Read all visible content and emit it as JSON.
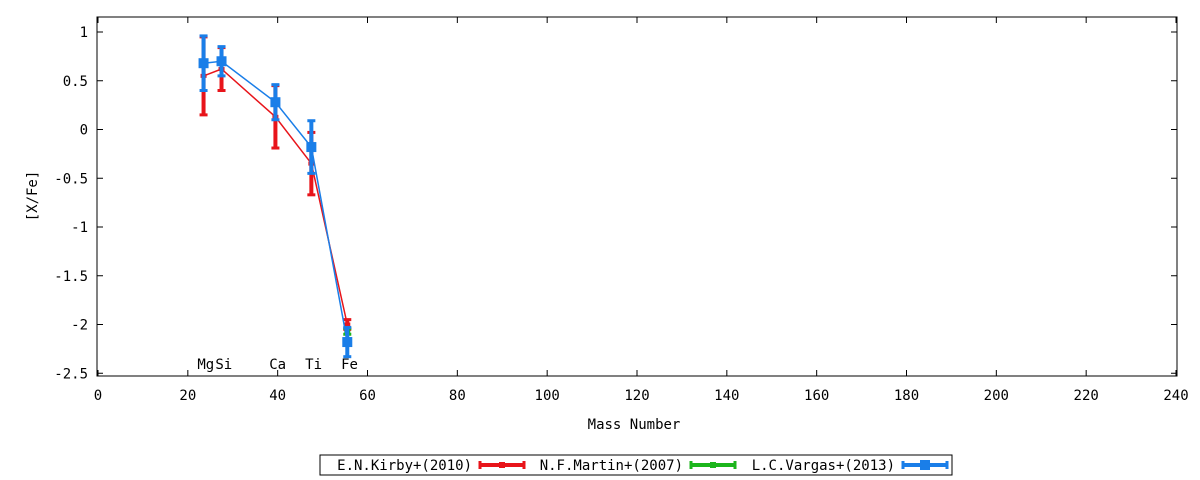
{
  "chart_data": {
    "type": "line",
    "xlabel": "Mass Number",
    "ylabel": "[X/Fe]",
    "xlim": [
      0,
      240
    ],
    "ylim": [
      -2.5,
      1.15
    ],
    "xticks": [
      0,
      20,
      40,
      60,
      80,
      100,
      120,
      140,
      160,
      180,
      200,
      220,
      240
    ],
    "yticks": [
      1,
      0.5,
      0,
      -0.5,
      -1,
      -1.5,
      -2,
      -2.5
    ],
    "yticklabels": [
      "1",
      "0.5",
      "0",
      "-0.5",
      "-1",
      "-1.5",
      "-2",
      "-2.5"
    ],
    "grid": false,
    "legend_position": "bottom-center",
    "element_labels": [
      {
        "text": "Mg",
        "x": 24
      },
      {
        "text": "Si",
        "x": 28
      },
      {
        "text": "Ca",
        "x": 40
      },
      {
        "text": "Ti",
        "x": 48
      },
      {
        "text": "Fe",
        "x": 56
      }
    ],
    "series": [
      {
        "name": "E.N.Kirby+(2010)",
        "color": "#e8141a",
        "x": [
          23.5,
          27.5,
          39.5,
          47.5,
          55.5
        ],
        "y": [
          0.55,
          0.62,
          0.13,
          -0.35,
          -2.0
        ],
        "err": [
          0.4,
          0.22,
          0.32,
          0.32,
          0.05
        ]
      },
      {
        "name": "N.F.Martin+(2007)",
        "color": "#1cb51c",
        "x": [
          55.5
        ],
        "y": [
          -2.07
        ],
        "err": [
          0.03
        ]
      },
      {
        "name": "L.C.Vargas+(2013)",
        "color": "#1a7ee8",
        "x": [
          23.5,
          27.5,
          39.5,
          47.5,
          55.5
        ],
        "y": [
          0.68,
          0.7,
          0.28,
          -0.18,
          -2.18
        ],
        "err": [
          0.28,
          0.15,
          0.18,
          0.27,
          0.15
        ]
      }
    ]
  }
}
